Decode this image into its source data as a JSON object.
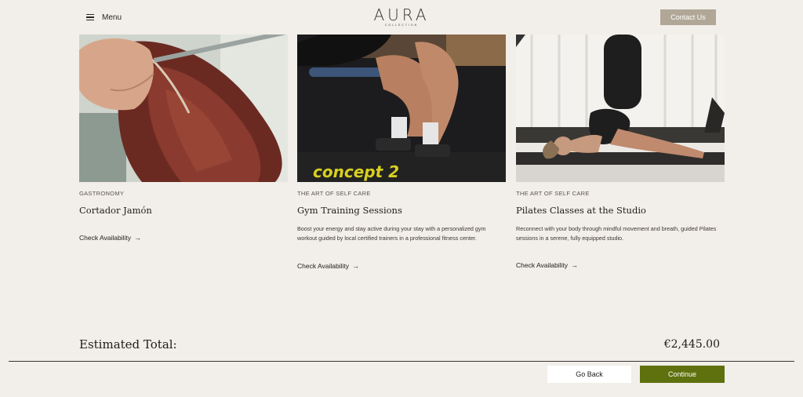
{
  "header": {
    "menu_label": "Menu",
    "logo_text": "AURA",
    "logo_subtext": "COLLECTION",
    "contact_label": "Contact Us"
  },
  "cards": [
    {
      "category": "GASTRONOMY",
      "title": "Cortador Jamón",
      "description": "",
      "cta": "Check Availability"
    },
    {
      "category": "THE ART OF SELF CARE",
      "title": "Gym Training Sessions",
      "description": "Boost your energy and stay active during your stay with a personalized gym workout guided by local certified trainers in a professional fitness center.",
      "cta": "Check Availability",
      "image_text": "concept 2"
    },
    {
      "category": "THE ART OF SELF CARE",
      "title": "Pilates Classes at the Studio",
      "description": "Reconnect with your body through mindful movement and breath, guided Pilates sessions in a serene, fully equipped studio.",
      "cta": "Check Availability"
    }
  ],
  "summary": {
    "total_label": "Estimated Total:",
    "total_value": "€2,445.00"
  },
  "footer": {
    "back_label": "Go Back",
    "continue_label": "Continue"
  },
  "colors": {
    "background": "#f2eee9",
    "contact_button": "#b0a797",
    "continue_button": "#5f710f"
  }
}
